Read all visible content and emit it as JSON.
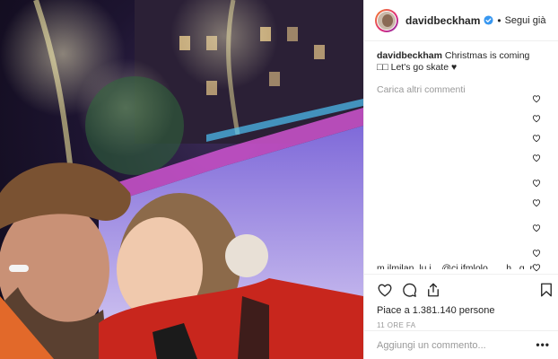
{
  "post": {
    "username": "davidbeckham",
    "follow_separator": "•",
    "follow_status": "Segui già",
    "caption_text": "Christmas is coming □□ Let's go skate ♥",
    "load_more_label": "Carica altri commenti",
    "cut_comment_text": "m.ilmilan_lu.i... @cj.ifmlolo... ...h...g..r.. ..... ... ..",
    "likes_text": "Piace a 1.381.140 persone",
    "time_ago": "11 ORE FA",
    "comment_placeholder": "Aggiungi un commento...",
    "options_label": "•••"
  },
  "icons": {
    "verified": "verified-badge-icon",
    "like": "heart-icon",
    "comment": "comment-icon",
    "share": "share-icon",
    "save": "bookmark-icon",
    "comment_like": "small-heart-icon"
  },
  "colors": {
    "verified": "#3897f0",
    "muted": "#999999",
    "text": "#262626",
    "border": "#efefef"
  }
}
